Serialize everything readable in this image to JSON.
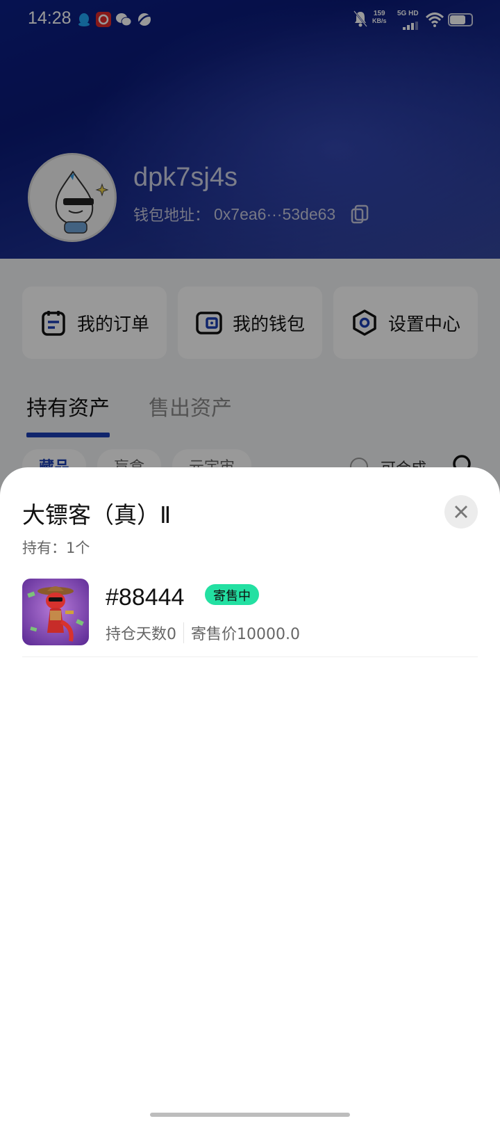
{
  "status_bar": {
    "time": "14:28",
    "speed_value": "159",
    "speed_unit": "KB/s",
    "network": "5G HD",
    "icons": [
      "qq-icon",
      "app-c-icon",
      "wechat-icon",
      "browser-icon",
      "bell-muted-icon",
      "signal-icon",
      "wifi-icon",
      "battery-icon"
    ]
  },
  "profile": {
    "username": "dpk7sj4s",
    "wallet_label": "钱包地址：",
    "wallet_address": "0x7ea6···53de63"
  },
  "shortcuts": [
    {
      "label": "我的订单",
      "icon": "order-icon"
    },
    {
      "label": "我的钱包",
      "icon": "wallet-icon"
    },
    {
      "label": "设置中心",
      "icon": "settings-icon"
    }
  ],
  "tabs": [
    {
      "label": "持有资产",
      "active": true
    },
    {
      "label": "售出资产",
      "active": false
    }
  ],
  "filters": {
    "chips": [
      "藏品",
      "盲盒",
      "元宇宙"
    ],
    "combine_label": "可合成"
  },
  "sheet": {
    "title": "大镖客（真）Ⅱ",
    "hold_text": "持有：1个",
    "items": [
      {
        "number": "#88444",
        "status": "寄售中",
        "hold_days": "持仓天数0",
        "price": "寄售价10000.0"
      }
    ]
  },
  "colors": {
    "accent": "#1b3fb4",
    "badge": "#23e0a2",
    "header_start": "#0b1f86",
    "header_end": "#35479e"
  }
}
